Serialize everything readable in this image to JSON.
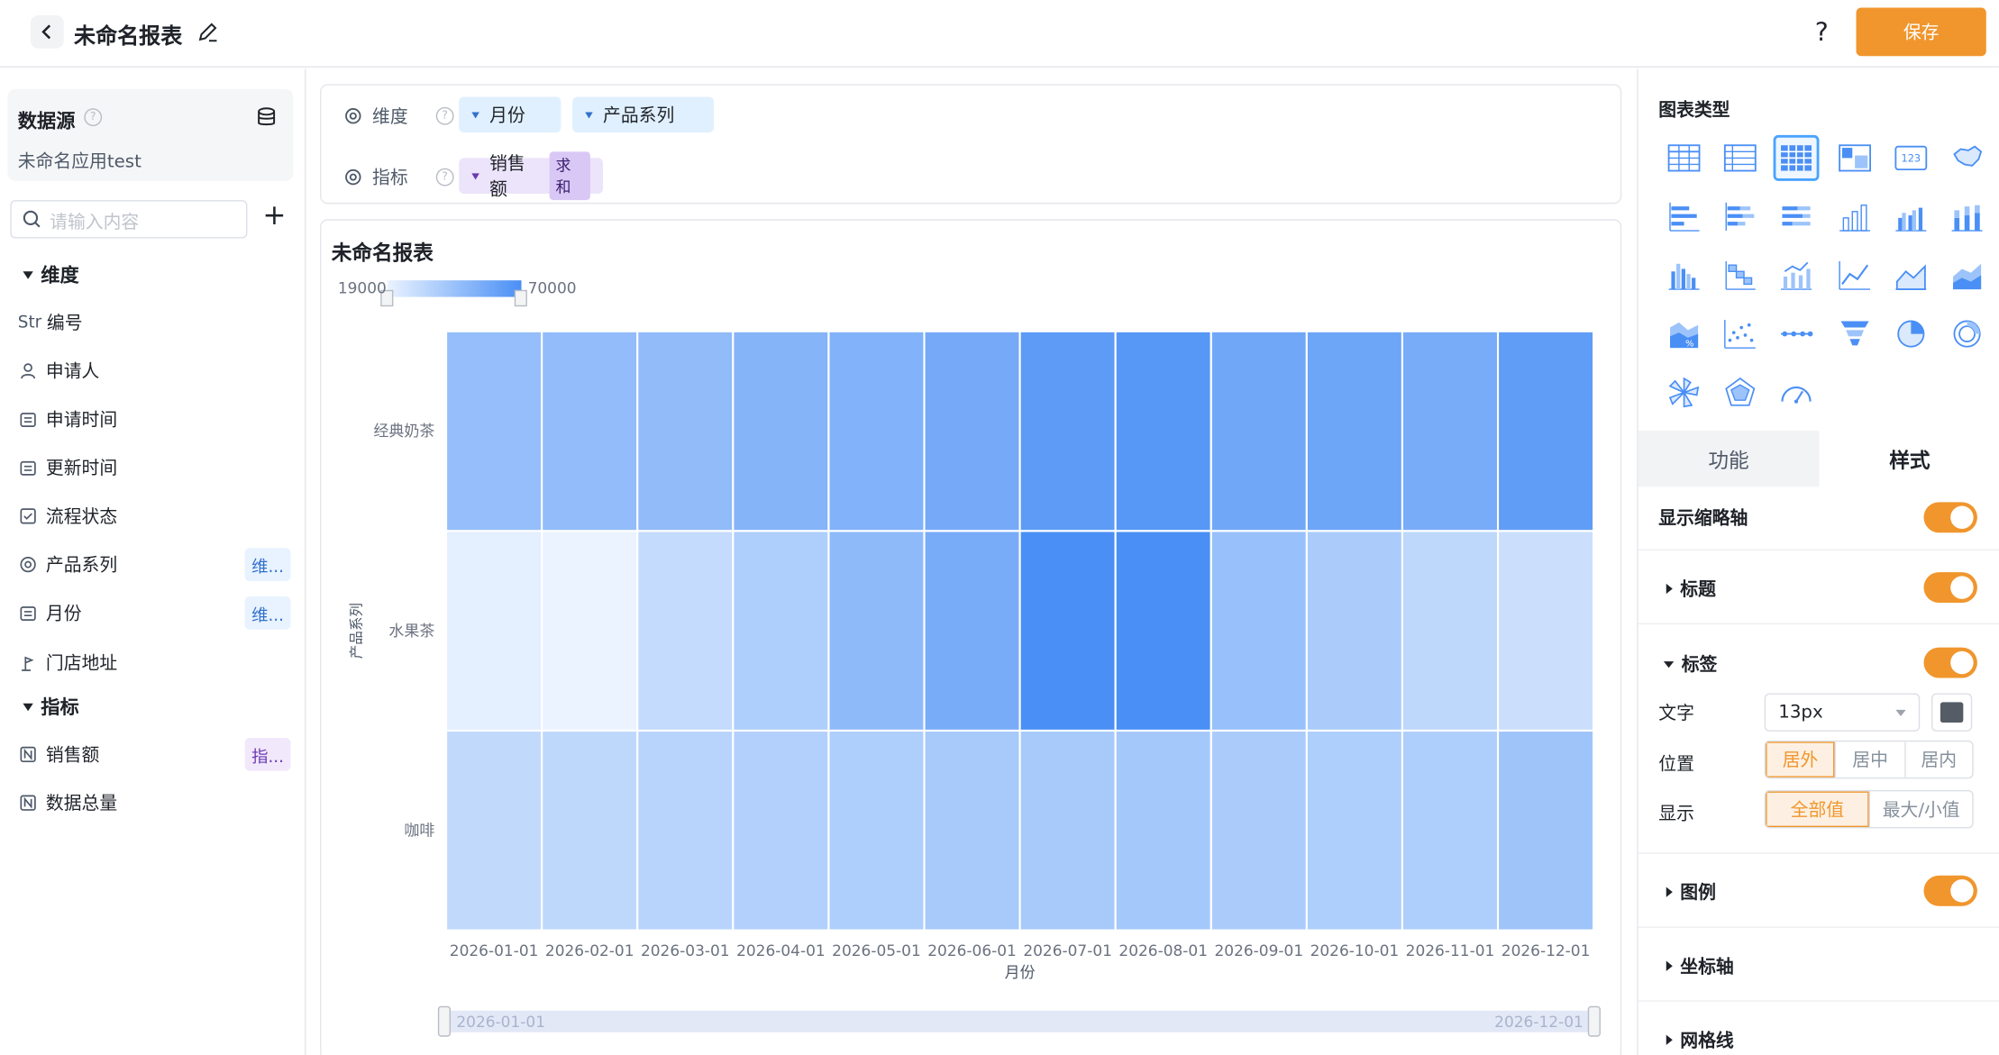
{
  "header": {
    "title": "未命名报表",
    "help": "?",
    "save": "保存"
  },
  "left": {
    "datasource_label": "数据源",
    "datasource_help": "?",
    "datasource_name": "未命名应用test",
    "search_placeholder": "请输入内容",
    "add": "+",
    "dimension_section": "维度",
    "metric_section": "指标",
    "dimensions": [
      {
        "icon": "Str",
        "label": "编号",
        "tag": ""
      },
      {
        "icon": "person-icon",
        "label": "申请人",
        "tag": ""
      },
      {
        "icon": "calendar-icon",
        "label": "申请时间",
        "tag": ""
      },
      {
        "icon": "calendar-icon",
        "label": "更新时间",
        "tag": ""
      },
      {
        "icon": "checkbox-icon",
        "label": "流程状态",
        "tag": ""
      },
      {
        "icon": "radio-icon",
        "label": "产品系列",
        "tag": "维..."
      },
      {
        "icon": "calendar-icon",
        "label": "月份",
        "tag": "维..."
      },
      {
        "icon": "location-icon",
        "label": "门店地址",
        "tag": ""
      }
    ],
    "metrics": [
      {
        "icon": "N",
        "label": "销售额",
        "tag": "指..."
      },
      {
        "icon": "N",
        "label": "数据总量",
        "tag": ""
      }
    ]
  },
  "config": {
    "dimension_label": "维度",
    "metric_label": "指标",
    "help": "?",
    "dimension_pills": [
      "月份",
      "产品系列"
    ],
    "metric_pill": "销售额",
    "metric_agg": "求和"
  },
  "colors": {
    "accent": "#f0962d",
    "heat_low": "#eaf3ff",
    "heat_high": "#4a8ff5"
  },
  "chart_data": {
    "type": "heatmap",
    "title": "未命名报表",
    "xlabel": "月份",
    "ylabel": "产品系列",
    "x": [
      "2026-01-01",
      "2026-02-01",
      "2026-03-01",
      "2026-04-01",
      "2026-05-01",
      "2026-06-01",
      "2026-07-01",
      "2026-08-01",
      "2026-09-01",
      "2026-10-01",
      "2026-11-01",
      "2026-12-01"
    ],
    "y": [
      "经典奶茶",
      "水果茶",
      "咖啡"
    ],
    "values": [
      [
        46000,
        47000,
        47500,
        51000,
        52000,
        56000,
        64000,
        66000,
        58000,
        59000,
        55000,
        63000
      ],
      [
        21000,
        19000,
        31000,
        38000,
        48000,
        55000,
        70000,
        70000,
        45000,
        39000,
        33000,
        29000
      ],
      [
        32000,
        33000,
        35000,
        37000,
        38000,
        40000,
        40000,
        41000,
        39000,
        38000,
        38000,
        43000
      ]
    ],
    "visual_map": {
      "min_label": "19000",
      "max_label": "70000",
      "min": 19000,
      "max": 70000
    },
    "zoom": {
      "start_label": "2026-01-01",
      "end_label": "2026-12-01"
    }
  },
  "right": {
    "chart_type_label": "图表类型",
    "tabs": [
      "功能",
      "样式"
    ],
    "show_zoom_axis": "显示缩略轴",
    "title_section": "标题",
    "label_section": "标签",
    "text_label": "文字",
    "font_size": "13px",
    "position_label": "位置",
    "positions": [
      "居外",
      "居中",
      "居内"
    ],
    "display_label": "显示",
    "displays": [
      "全部值",
      "最大/小值"
    ],
    "legend_section": "图例",
    "axis_section": "坐标轴",
    "grid_section": "网格线"
  }
}
